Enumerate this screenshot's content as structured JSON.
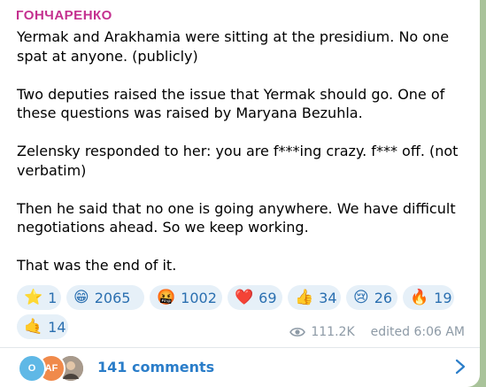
{
  "message": {
    "sender": "ГОНЧАРЕНКО",
    "paragraphs": [
      "Yermak and Arakhamia were sitting at the presidium. No one spat at anyone. (publicly)",
      "Two deputies raised the issue that Yermak should go. One of these questions was raised by Maryana Bezuhla.",
      "Zelensky responded to her: you are f***ing crazy. f*** off. (not verbatim)",
      "Then he said that no one is going anywhere. We have difficult negotiations ahead. So we keep working.",
      "That was the end of it."
    ],
    "reactions": [
      {
        "emoji": "⭐",
        "count": "1",
        "icon": "star-icon"
      },
      {
        "emoji": "😁",
        "count": "2065",
        "icon": "grin-icon"
      },
      {
        "emoji": "🤬",
        "count": "1002",
        "icon": "cursing-face-icon"
      },
      {
        "emoji": "❤️",
        "count": "69",
        "icon": "heart-icon"
      },
      {
        "emoji": "👍",
        "count": "34",
        "icon": "thumbs-up-icon"
      },
      {
        "emoji": "😢",
        "count": "26",
        "icon": "crying-face-icon"
      },
      {
        "emoji": "🔥",
        "count": "19",
        "icon": "fire-icon"
      },
      {
        "emoji": "🤙",
        "count": "14",
        "icon": "call-me-hand-icon"
      }
    ],
    "views": "111.2K",
    "edited": "edited 6:06 AM"
  },
  "comments": {
    "label": "141 comments",
    "avatars": [
      {
        "initials": "O",
        "color": "#5fb8e6"
      },
      {
        "initials": "AF",
        "color": "#f08a4b"
      },
      {
        "initials": "",
        "color": "#8a7d70"
      }
    ]
  },
  "colors": {
    "sender": "#c4308f",
    "link": "#2a7dc9",
    "chip_bg": "#e6f0f8"
  }
}
